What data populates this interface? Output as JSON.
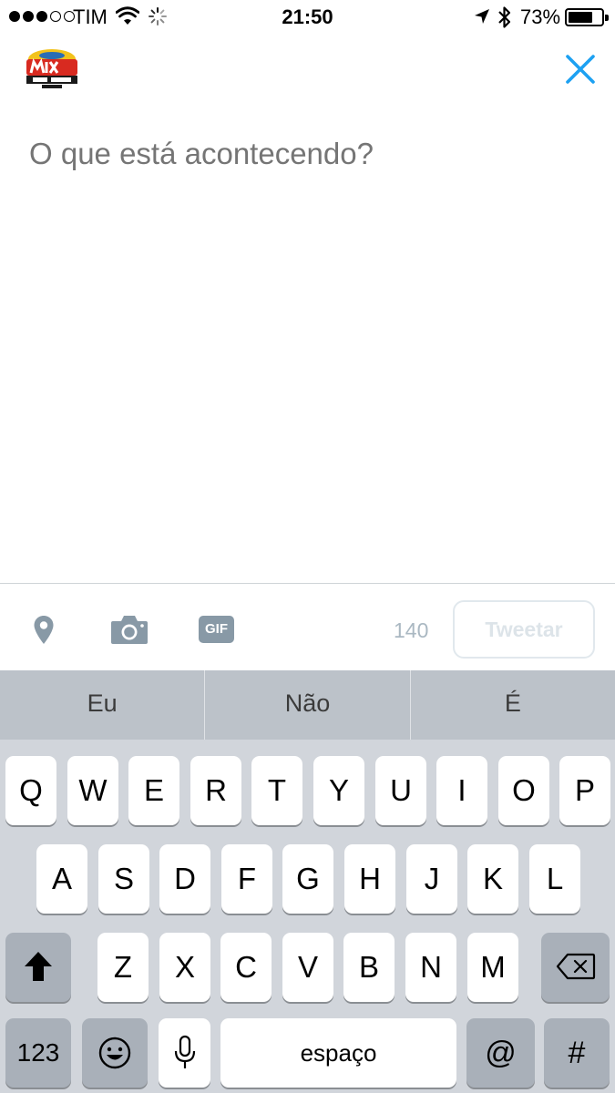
{
  "status_bar": {
    "carrier": "TIM",
    "time": "21:50",
    "battery": "73%",
    "battery_level": 0.73,
    "signal_bars": 3,
    "signal_total": 5
  },
  "compose": {
    "placeholder": "O que está acontecendo?"
  },
  "toolbar": {
    "char_count": "140",
    "tweet_label": "Tweetar",
    "gif_label": "GIF"
  },
  "predictions": [
    "Eu",
    "Não",
    "É"
  ],
  "keyboard": {
    "row1": [
      "Q",
      "W",
      "E",
      "R",
      "T",
      "Y",
      "U",
      "I",
      "O",
      "P"
    ],
    "row2": [
      "A",
      "S",
      "D",
      "F",
      "G",
      "H",
      "J",
      "K",
      "L"
    ],
    "row3": [
      "Z",
      "X",
      "C",
      "V",
      "B",
      "N",
      "M"
    ],
    "numbers_label": "123",
    "space_label": "espaço",
    "at_label": "@",
    "hash_label": "#"
  },
  "colors": {
    "accent": "#1da1f2",
    "placeholder": "#ccd6dd",
    "icon_gray": "#8899a6"
  }
}
